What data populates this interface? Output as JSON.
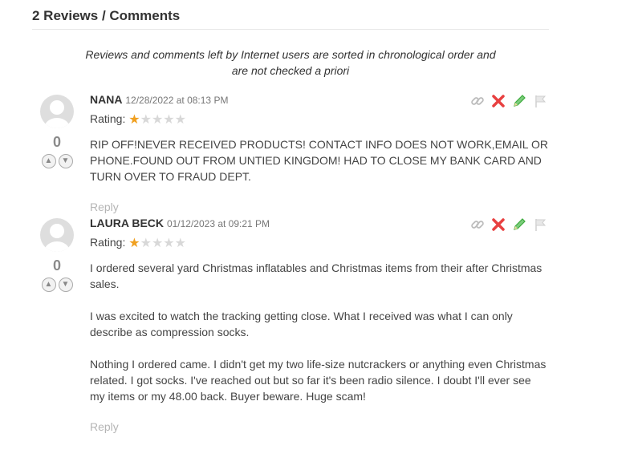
{
  "section": {
    "title": "2 Reviews / Comments"
  },
  "notice": {
    "line1": "Reviews and comments left by Internet users are sorted in chronological order and",
    "line2": "are not checked a priori"
  },
  "comments": [
    {
      "author": "NANA",
      "date": "12/28/2022 at 08:13 PM",
      "rating_label": "Rating:",
      "rating": 1,
      "rating_max": 5,
      "votes": "0",
      "paragraphs": [
        "RIP OFF!NEVER RECEIVED PRODUCTS! CONTACT INFO DOES NOT WORK,EMAIL OR PHONE.FOUND OUT FROM UNTIED KINGDOM! HAD TO CLOSE MY BANK CARD AND TURN OVER TO FRAUD DEPT."
      ],
      "reply_label": "Reply"
    },
    {
      "author": "LAURA BECK",
      "date": "01/12/2023 at 09:21 PM",
      "rating_label": "Rating:",
      "rating": 1,
      "rating_max": 5,
      "votes": "0",
      "paragraphs": [
        "I ordered several yard Christmas inflatables and Christmas items from their after Christmas sales.",
        "I was excited to watch the tracking getting close. What I received was what I can only describe as compression socks.",
        "Nothing I ordered came. I didn't get my two life-size nutcrackers or anything even Christmas related. I got socks. I've reached out but so far it's been radio silence. I doubt I'll ever see my items or my 48.00 back. Buyer beware. Huge scam!"
      ],
      "reply_label": "Reply"
    }
  ],
  "icons": {
    "link": "link-icon",
    "delete": "delete-icon",
    "edit": "edit-icon",
    "flag": "flag-icon",
    "like": "thumbs-up-icon",
    "dislike": "thumbs-down-icon"
  },
  "colors": {
    "star_on": "#f0a020",
    "star_off": "#d8d8d8",
    "delete": "#e84040",
    "edit": "#3cab3c"
  }
}
